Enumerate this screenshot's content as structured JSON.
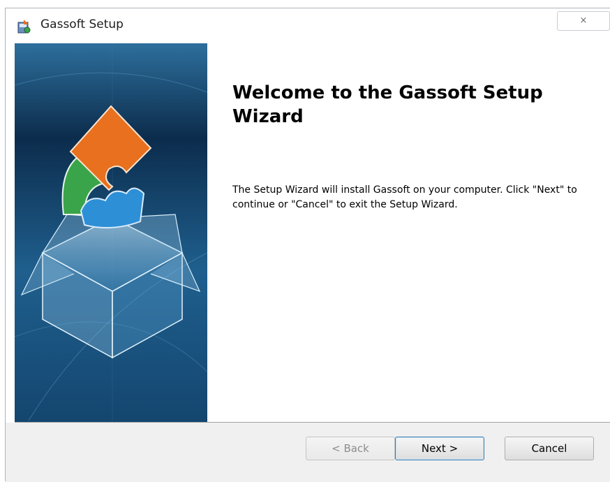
{
  "window": {
    "title": "Gassoft Setup",
    "close_glyph": "×",
    "icon": "installer-icon"
  },
  "wizard": {
    "heading": "Welcome to the Gassoft Setup Wizard",
    "description": "The Setup Wizard will install Gassoft on your computer.  Click \"Next\" to continue or \"Cancel\" to exit the Setup Wizard."
  },
  "sidebar": {
    "image": "setup-box-puzzle-illustration",
    "colors": {
      "bg_dark": "#0b2a4a",
      "bg_light": "#2a6a99",
      "orange": "#e8701e",
      "green": "#3aa44a",
      "blue": "#2d8fd6"
    }
  },
  "buttons": {
    "back": "< Back",
    "next": "Next >",
    "cancel": "Cancel"
  }
}
